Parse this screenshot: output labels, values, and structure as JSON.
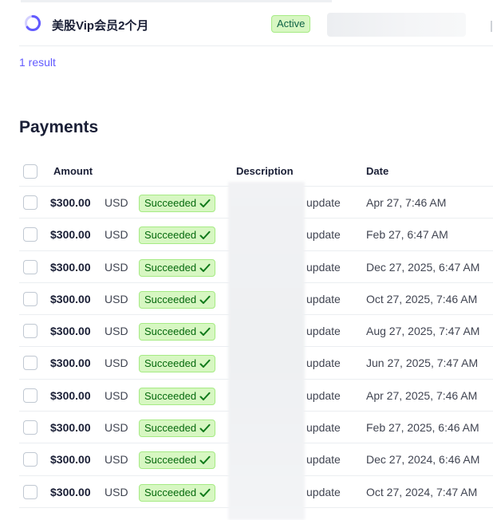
{
  "subscription": {
    "name": "美股Vip会员2个月",
    "status": "Active"
  },
  "result_count": "1 result",
  "payments": {
    "title": "Payments",
    "columns": {
      "amount": "Amount",
      "description": "Description",
      "date": "Date"
    },
    "rows": [
      {
        "amount": "$300.00",
        "currency": "USD",
        "status": "Succeeded",
        "description": "update",
        "date": "Apr 27, 7:46 AM"
      },
      {
        "amount": "$300.00",
        "currency": "USD",
        "status": "Succeeded",
        "description": "update",
        "date": "Feb 27, 6:47 AM"
      },
      {
        "amount": "$300.00",
        "currency": "USD",
        "status": "Succeeded",
        "description": "update",
        "date": "Dec 27, 2025, 6:47 AM"
      },
      {
        "amount": "$300.00",
        "currency": "USD",
        "status": "Succeeded",
        "description": "update",
        "date": "Oct 27, 2025, 7:46 AM"
      },
      {
        "amount": "$300.00",
        "currency": "USD",
        "status": "Succeeded",
        "description": "update",
        "date": "Aug 27, 2025, 7:47 AM"
      },
      {
        "amount": "$300.00",
        "currency": "USD",
        "status": "Succeeded",
        "description": "update",
        "date": "Jun 27, 2025, 7:47 AM"
      },
      {
        "amount": "$300.00",
        "currency": "USD",
        "status": "Succeeded",
        "description": "update",
        "date": "Apr 27, 2025, 7:46 AM"
      },
      {
        "amount": "$300.00",
        "currency": "USD",
        "status": "Succeeded",
        "description": "update",
        "date": "Feb 27, 2025, 6:46 AM"
      },
      {
        "amount": "$300.00",
        "currency": "USD",
        "status": "Succeeded",
        "description": "update",
        "date": "Dec 27, 2024, 6:46 AM"
      },
      {
        "amount": "$300.00",
        "currency": "USD",
        "status": "Succeeded",
        "description": "update",
        "date": "Oct 27, 2024, 7:47 AM"
      }
    ]
  },
  "colors": {
    "accent": "#635bff",
    "success_bg": "#d7f7c2",
    "success_text": "#05690d"
  },
  "icons": {
    "subscription": "progress-ring-icon",
    "status": "check-icon"
  }
}
